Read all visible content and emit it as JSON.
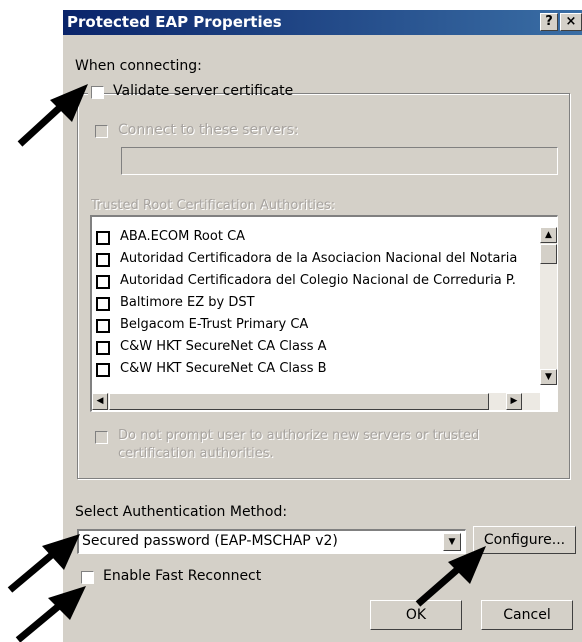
{
  "window": {
    "title": "Protected EAP Properties",
    "help_button": "?",
    "close_button": "×"
  },
  "connecting": {
    "label": "When connecting:",
    "validate_label": "Validate server certificate",
    "validate_checked": false,
    "connect_label": "Connect to these servers:",
    "servers_value": "",
    "trusted_label": "Trusted Root Certification Authorities:",
    "authorities": [
      {
        "name": "ABA.ECOM Root CA",
        "checked": false
      },
      {
        "name": "Autoridad Certificadora de la Asociacion Nacional del Notaria",
        "checked": false
      },
      {
        "name": "Autoridad Certificadora del Colegio Nacional de Correduria P.",
        "checked": false
      },
      {
        "name": "Baltimore EZ by DST",
        "checked": false
      },
      {
        "name": "Belgacom E-Trust Primary CA",
        "checked": false
      },
      {
        "name": "C&W HKT SecureNet CA Class A",
        "checked": false
      },
      {
        "name": "C&W HKT SecureNet CA Class B",
        "checked": false
      }
    ],
    "no_prompt_line1": "Do not prompt user to authorize new servers or trusted",
    "no_prompt_line2": "certification authorities."
  },
  "auth": {
    "label": "Select Authentication Method:",
    "selected": "Secured password (EAP-MSCHAP v2)",
    "configure_button": "Configure...",
    "fast_reconnect_label": "Enable Fast Reconnect",
    "fast_reconnect_checked": false
  },
  "footer": {
    "ok": "OK",
    "cancel": "Cancel"
  },
  "icons": {
    "scroll_up": "scroll-up-arrow",
    "scroll_down": "scroll-down-arrow",
    "scroll_left": "scroll-left-arrow",
    "scroll_right": "scroll-right-arrow",
    "dropdown": "dropdown-arrow",
    "annotation": "pointer-arrow"
  }
}
